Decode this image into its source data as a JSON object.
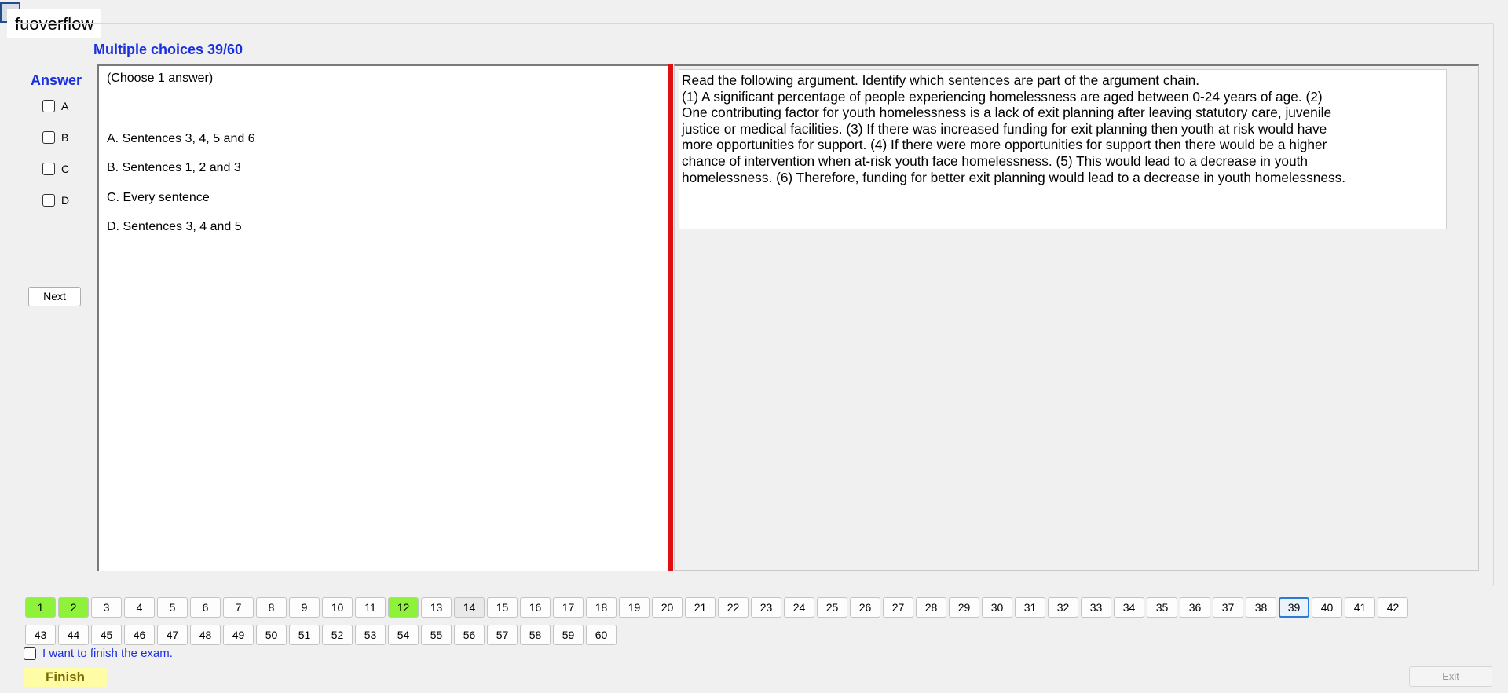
{
  "window": {
    "title": "fuoverflow"
  },
  "header": {
    "progress_label": "Multiple choices 39/60"
  },
  "answer_panel": {
    "title": "Answer",
    "options": [
      "A",
      "B",
      "C",
      "D"
    ],
    "next_label": "Next"
  },
  "choices": {
    "hint": "(Choose 1 answer)",
    "items": [
      "A.  Sentences 3, 4, 5 and 6",
      "B.  Sentences 1, 2 and 3",
      "C.  Every sentence",
      "D.  Sentences 3, 4 and 5"
    ]
  },
  "question": {
    "lines": [
      "Read the following argument. Identify which sentences are part of the argument chain.",
      "(1) A significant percentage of people experiencing homelessness are aged between 0-24 years of age. (2)",
      "One contributing factor for youth homelessness is a lack of exit planning after leaving statutory care, juvenile",
      "justice or medical facilities. (3) If there was increased funding for exit planning then youth at risk would have",
      "more opportunities for support. (4) If there were more opportunities for support then there would be a higher",
      "chance of intervention when at-risk youth face homelessness. (5) This would lead to a decrease in youth",
      "homelessness. (6) Therefore, funding for better exit planning would lead to a decrease in youth homelessness."
    ]
  },
  "navigation": {
    "row1": [
      "1",
      "2",
      "3",
      "4",
      "5",
      "6",
      "7",
      "8",
      "9",
      "10",
      "11",
      "12",
      "13",
      "14",
      "15",
      "16",
      "17",
      "18",
      "19",
      "20",
      "21",
      "22",
      "23",
      "24",
      "25",
      "26",
      "27",
      "28",
      "29",
      "30",
      "31",
      "32",
      "33",
      "34",
      "35",
      "36",
      "37",
      "38",
      "39",
      "40",
      "41",
      "42"
    ],
    "row2": [
      "43",
      "44",
      "45",
      "46",
      "47",
      "48",
      "49",
      "50",
      "51",
      "52",
      "53",
      "54",
      "55",
      "56",
      "57",
      "58",
      "59",
      "60"
    ],
    "answered": [
      "1",
      "2",
      "12"
    ],
    "visited": [
      "14"
    ],
    "current": "39",
    "answered_color": "#8ff23a",
    "current_color": "#2b7bd6"
  },
  "footer": {
    "finish_checkbox_label": "I want to finish the exam.",
    "finish_label": "Finish",
    "exit_label": "Exit"
  }
}
